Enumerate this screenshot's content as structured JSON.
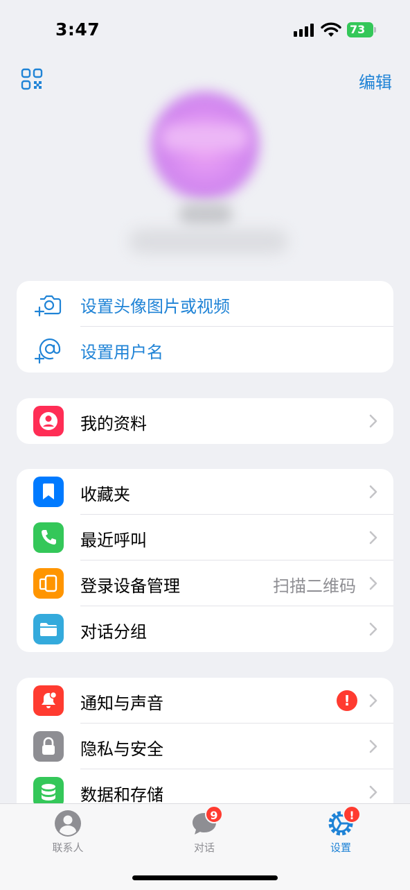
{
  "status_bar": {
    "time": "3:47",
    "battery": "73"
  },
  "header": {
    "edit_label": "编辑",
    "qr_icon": "qr-code-icon"
  },
  "profile_actions": [
    {
      "label": "设置头像图片或视频",
      "icon": "camera-add-icon"
    },
    {
      "label": "设置用户名",
      "icon": "at-add-icon"
    }
  ],
  "profile_group": [
    {
      "label": "我的资料",
      "icon": "profile-icon",
      "color": "#ff2d55"
    }
  ],
  "main_group": [
    {
      "label": "收藏夹",
      "icon": "bookmark-icon",
      "color": "#007aff"
    },
    {
      "label": "最近呼叫",
      "icon": "phone-icon",
      "color": "#34c759"
    },
    {
      "label": "登录设备管理",
      "icon": "devices-icon",
      "color": "#ff9500",
      "detail": "扫描二维码"
    },
    {
      "label": "对话分组",
      "icon": "folder-icon",
      "color": "#34aadc"
    }
  ],
  "settings_group": [
    {
      "label": "通知与声音",
      "icon": "bell-icon",
      "color": "#ff3b30",
      "badge": "!"
    },
    {
      "label": "隐私与安全",
      "icon": "lock-icon",
      "color": "#8e8e93"
    },
    {
      "label": "数据和存储",
      "icon": "database-icon",
      "color": "#34c759"
    }
  ],
  "tabs": [
    {
      "label": "联系人",
      "icon": "contacts-icon",
      "active": false
    },
    {
      "label": "对话",
      "icon": "chats-icon",
      "active": false,
      "badge": "9"
    },
    {
      "label": "设置",
      "icon": "settings-icon",
      "active": true,
      "badge": "!"
    }
  ],
  "colors": {
    "accent": "#1f83d6",
    "badge": "#ff3b30",
    "background": "#eff0f4"
  }
}
